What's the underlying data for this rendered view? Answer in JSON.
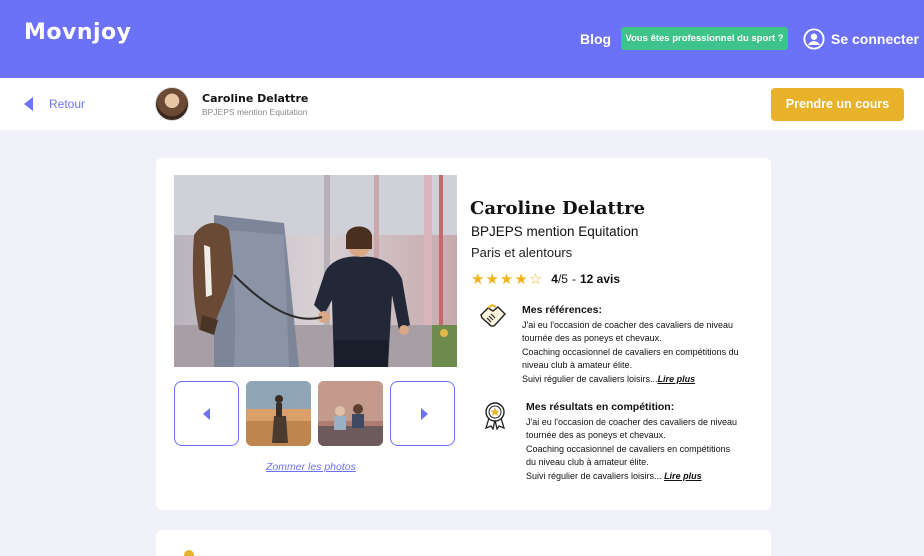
{
  "header": {
    "logo": "Movnjoy",
    "blog": "Blog",
    "pro_button": "Vous êtes professionnel du sport ?",
    "login": "Se connecter"
  },
  "subheader": {
    "back": "Retour",
    "name": "Caroline Delattre",
    "subtitle": "BPJEPS mention Equitation",
    "cta": "Prendre un cours"
  },
  "profile": {
    "name": "Caroline Delattre",
    "diploma": "BPJEPS mention Equitation",
    "area": "Paris et alentours",
    "rating": {
      "value": 4,
      "max": 5,
      "score_text": "4",
      "max_text": "/5",
      "separator": "-",
      "reviews": "12 avis"
    },
    "zoom_link": "Zommer les photos"
  },
  "references": {
    "title": "Mes références:",
    "lines": [
      "J'ai eu l'occasion de coacher des cavaliers de niveau",
      "tournée des as poneys et chevaux.",
      "Coaching occasionnel de cavaliers en compétitions du",
      "niveau club à amateur élite.",
      "Suivi régulier de cavaliers loisirs..."
    ],
    "more": "Lire plus"
  },
  "results": {
    "title": "Mes résultats en compétition:",
    "lines": [
      "J'ai eu l'occasion de coacher des cavaliers de niveau",
      "tournée des as poneys et chevaux.",
      "Coaching occasionnel de cavaliers en compétitions",
      "du niveau club à amateur élite.",
      "Suivi régulier de cavaliers loisirs... "
    ],
    "more": "Lire plus"
  },
  "colors": {
    "primary": "#6c72f8",
    "accent": "#e8b22b",
    "pro_green": "#3ec48a",
    "star": "#f3b31b"
  },
  "icons": {
    "user": "user-circle-icon",
    "back": "back-arrow-icon",
    "references": "handshake-icon",
    "results": "award-medal-icon"
  }
}
